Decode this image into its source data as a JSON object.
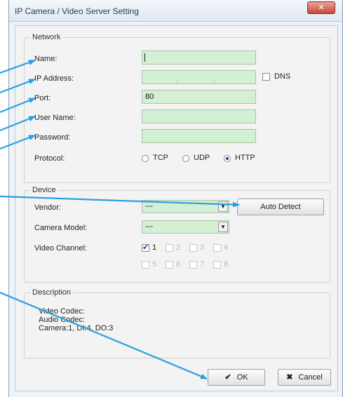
{
  "window": {
    "title": "IP Camera / Video Server Setting",
    "close_label": "✕"
  },
  "network": {
    "group_label": "Network",
    "name_label": "Name:",
    "name_value": "",
    "ip_label": "IP Address:",
    "ip_value": ". . .",
    "dns_label": "DNS",
    "port_label": "Port:",
    "port_value": "80",
    "username_label": "User Name:",
    "username_value": "",
    "password_label": "Password:",
    "password_value": "",
    "protocol_label": "Protocol:",
    "protocol_options": [
      "TCP",
      "UDP",
      "HTTP"
    ],
    "protocol_selected": "HTTP"
  },
  "device": {
    "group_label": "Device",
    "vendor_label": "Vendor:",
    "vendor_value": "---",
    "auto_detect_label": "Auto Detect",
    "model_label": "Camera Model:",
    "model_value": "---",
    "channel_label": "Video Channel:",
    "channels": [
      "1",
      "2",
      "3",
      "4",
      "5",
      "6",
      "7",
      "8"
    ],
    "channels_checked": [
      "1"
    ]
  },
  "description": {
    "group_label": "Description",
    "video_codec": "Video Codec:",
    "audio_codec": "Audio Codec:",
    "camera_info": "Camera:1, DI:4, DO:3"
  },
  "buttons": {
    "ok_label": "OK",
    "cancel_label": "Cancel"
  },
  "colors": {
    "accent_arrow": "#2a9fe0",
    "field_bg": "#d4f0d4"
  }
}
